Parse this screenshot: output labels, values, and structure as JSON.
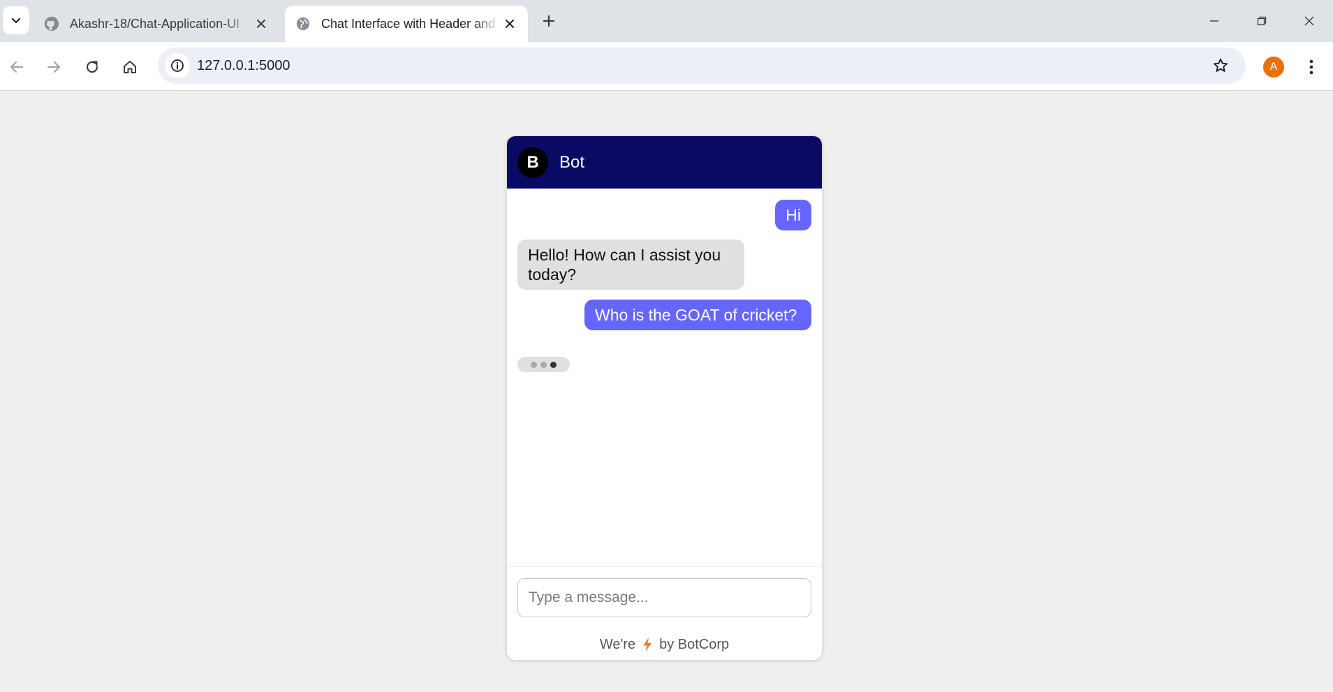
{
  "browser": {
    "tabs": [
      {
        "title": "Akashr-18/Chat-Application-UI",
        "favicon": "github-icon",
        "active": false
      },
      {
        "title": "Chat Interface with Header and",
        "favicon": "globe-icon",
        "active": true
      }
    ],
    "url": "127.0.0.1:5000",
    "profile_initial": "A",
    "profile_color": "#e8710a"
  },
  "chat": {
    "header": {
      "avatar_letter": "B",
      "bot_name": "Bot",
      "color": "#0a0a64"
    },
    "messages": [
      {
        "from": "user",
        "text": "Hi"
      },
      {
        "from": "bot",
        "text": "Hello! How can I assist you today?"
      },
      {
        "from": "user",
        "text": "Who is the GOAT of cricket?"
      }
    ],
    "typing_indicator": true,
    "input": {
      "placeholder": "Type a message...",
      "value": ""
    },
    "footer": {
      "prefix": "We're",
      "icon": "lightning-bolt-icon",
      "suffix": "by BotCorp"
    },
    "colors": {
      "user_bubble": "#6666ff",
      "bot_bubble": "#e0e0e0",
      "bolt": "#f57c1f"
    }
  }
}
